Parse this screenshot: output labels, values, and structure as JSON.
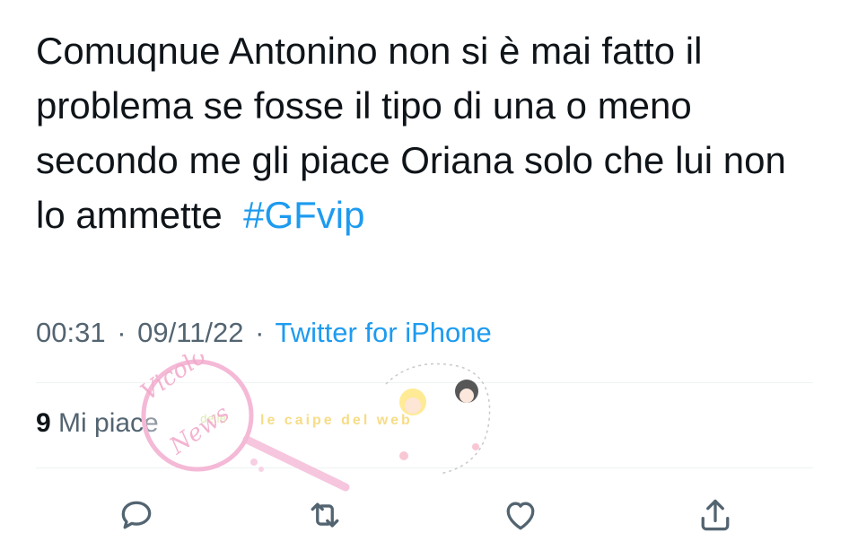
{
  "tweet": {
    "text_before_hashtag": "Comuqnue Antonino non si è mai fatto il problema se fosse il tipo di una o meno secondo me gli piace Oriana solo che lui non lo ammette  ",
    "hashtag": "#GFvip",
    "time": "00:31",
    "separator": "·",
    "date": "09/11/22",
    "source": "Twitter for iPhone"
  },
  "engagement": {
    "likes_count": "9",
    "likes_label": "Mi piace"
  },
  "actions": {
    "reply_icon": "reply-icon",
    "retweet_icon": "retweet-icon",
    "like_icon": "heart-icon",
    "share_icon": "share-icon"
  },
  "watermark": {
    "stamp_text": "Vicolo delle News",
    "banner_text": "le caipe del web"
  },
  "colors": {
    "text": "#0f1419",
    "secondary": "#536471",
    "link": "#1d9bf0",
    "divider": "#eff3f4"
  }
}
